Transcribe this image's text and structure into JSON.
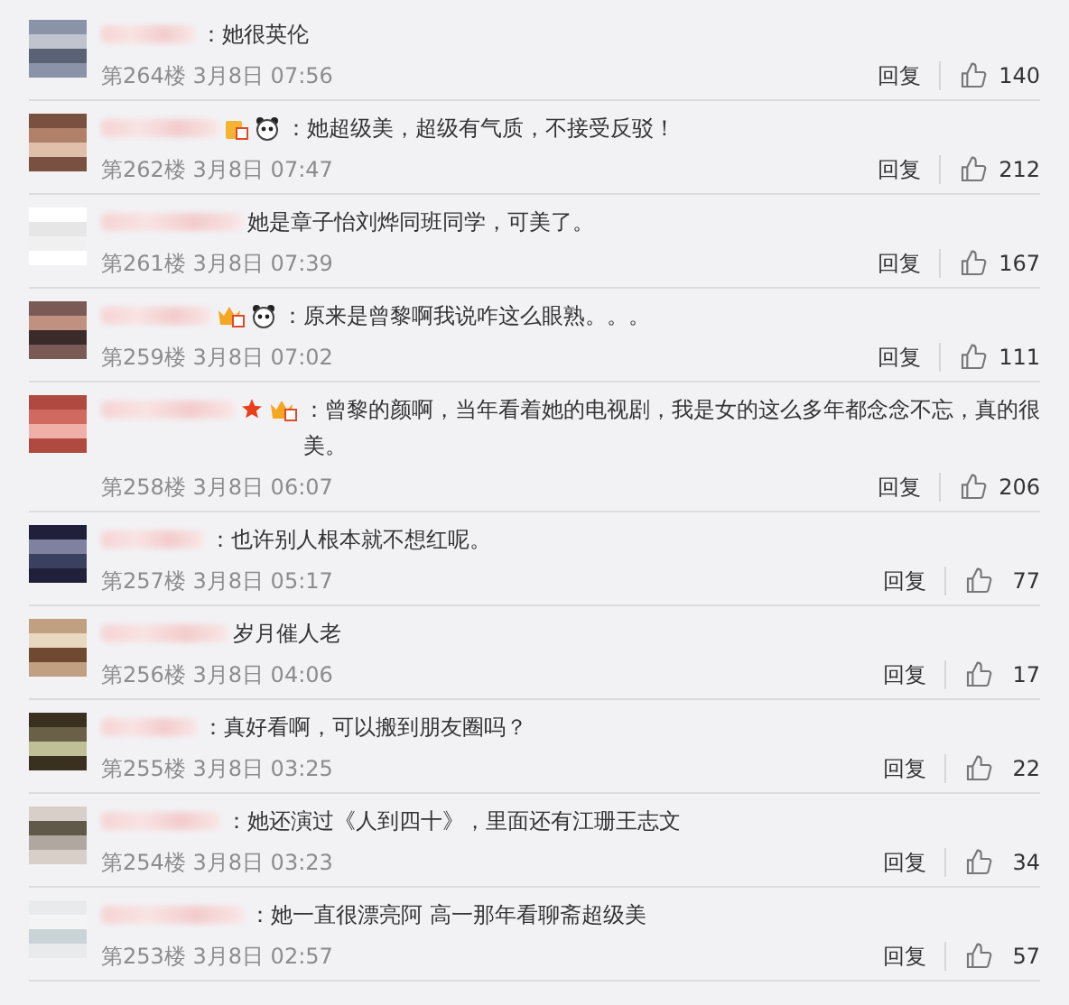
{
  "comments": [
    {
      "text": "：她很英伦",
      "meta": "第264楼 3月8日 07:56",
      "reply": "回复",
      "likes": "140"
    },
    {
      "badges": [
        {
          "kind": "level"
        },
        {
          "kind": "panda"
        }
      ],
      "text": "：她超级美，超级有气质，不接受反驳！",
      "meta": "第262楼 3月8日 07:47",
      "reply": "回复",
      "likes": "212"
    },
    {
      "text": "她是章子怡刘烨同班同学，可美了。",
      "meta": "第261楼 3月8日 07:39",
      "reply": "回复",
      "likes": "167"
    },
    {
      "badges": [
        {
          "kind": "crown"
        },
        {
          "kind": "panda"
        }
      ],
      "text": "：原来是曾黎啊我说咋这么眼熟。。。",
      "meta": "第259楼 3月8日 07:02",
      "reply": "回复",
      "likes": "111"
    },
    {
      "badges": [
        {
          "kind": "star"
        },
        {
          "kind": "crown"
        }
      ],
      "text": "：曾黎的颜啊，当年看着她的电视剧，我是女的这么多年都念念不忘，真的很美。",
      "meta": "第258楼 3月8日 06:07",
      "reply": "回复",
      "likes": "206"
    },
    {
      "text": "：也许别人根本就不想红呢。",
      "meta": "第257楼 3月8日 05:17",
      "reply": "回复",
      "likes": "77"
    },
    {
      "text": "岁月催人老",
      "meta": "第256楼 3月8日 04:06",
      "reply": "回复",
      "likes": "17"
    },
    {
      "text": "：真好看啊，可以搬到朋友圈吗？",
      "meta": "第255楼 3月8日 03:25",
      "reply": "回复",
      "likes": "22"
    },
    {
      "text": "：她还演过《人到四十》，里面还有江珊王志文",
      "meta": "第254楼 3月8日 03:23",
      "reply": "回复",
      "likes": "34"
    },
    {
      "text": "：她一直很漂亮阿 高一那年看聊斋超级美",
      "meta": "第253楼 3月8日 02:57",
      "reply": "回复",
      "likes": "57"
    }
  ]
}
